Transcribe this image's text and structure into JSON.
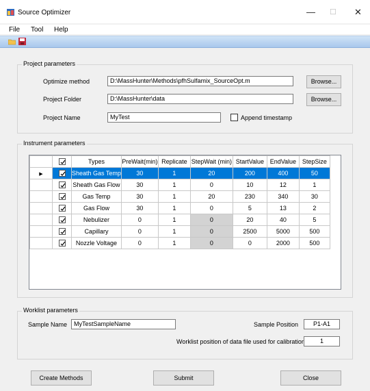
{
  "window": {
    "title": "Source Optimizer"
  },
  "menu": [
    "File",
    "Tool",
    "Help"
  ],
  "project": {
    "group_title": "Project parameters",
    "optimize_label": "Optimize method",
    "optimize_value": "D:\\MassHunter\\Methods\\pfhSulfamix_SourceOpt.m",
    "folder_label": "Project Folder",
    "folder_value": "D:\\MassHunter\\data",
    "name_label": "Project Name",
    "name_value": "MyTest",
    "browse_label": "Browse...",
    "append_label": "Append timestamp"
  },
  "instrument": {
    "group_title": "Instrument parameters",
    "columns": [
      "Types",
      "PreWait(min)",
      "Replicate",
      "StepWait (min)",
      "StartValue",
      "EndValue",
      "StepSize"
    ],
    "rows": [
      {
        "types": "Sheath Gas Temp",
        "prewait": "30",
        "replicate": "1",
        "stepwait": "20",
        "start": "200",
        "end": "400",
        "step": "50",
        "checked": true
      },
      {
        "types": "Sheath Gas Flow",
        "prewait": "30",
        "replicate": "1",
        "stepwait": "0",
        "start": "10",
        "end": "12",
        "step": "1",
        "checked": true
      },
      {
        "types": "Gas Temp",
        "prewait": "30",
        "replicate": "1",
        "stepwait": "20",
        "start": "230",
        "end": "340",
        "step": "30",
        "checked": true
      },
      {
        "types": "Gas Flow",
        "prewait": "30",
        "replicate": "1",
        "stepwait": "0",
        "start": "5",
        "end": "13",
        "step": "2",
        "checked": true
      },
      {
        "types": "Nebulizer",
        "prewait": "0",
        "replicate": "1",
        "stepwait": "0",
        "start": "20",
        "end": "40",
        "step": "5",
        "checked": true
      },
      {
        "types": "Capillary",
        "prewait": "0",
        "replicate": "1",
        "stepwait": "0",
        "start": "2500",
        "end": "5000",
        "step": "500",
        "checked": true
      },
      {
        "types": "Nozzle Voltage",
        "prewait": "0",
        "replicate": "1",
        "stepwait": "0",
        "start": "0",
        "end": "2000",
        "step": "500",
        "checked": true
      }
    ]
  },
  "worklist": {
    "group_title": "Worklist parameters",
    "sample_name_label": "Sample Name",
    "sample_name_value": "MyTestSampleName",
    "sample_pos_label": "Sample Position",
    "sample_pos_value": "P1-A1",
    "calib_label": "Worklist position of data file used for calibration",
    "calib_value": "1"
  },
  "buttons": {
    "create": "Create Methods",
    "submit": "Submit",
    "close": "Close"
  },
  "colors": {
    "selection": "#0078d7",
    "disabled_cell": "#d3d3d3"
  }
}
